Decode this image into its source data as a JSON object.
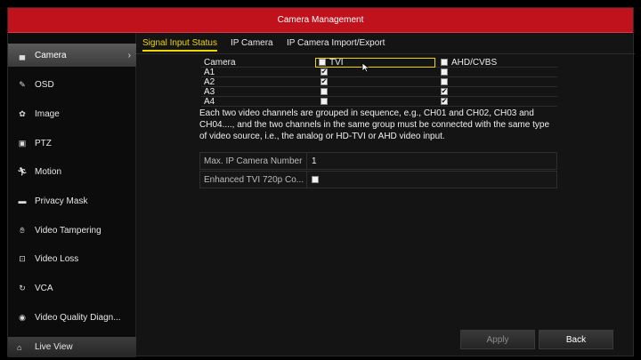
{
  "window": {
    "title": "Camera Management"
  },
  "sidebar": {
    "items": [
      {
        "label": "Camera",
        "icon": "camera-icon"
      },
      {
        "label": "OSD",
        "icon": "pencil-icon"
      },
      {
        "label": "Image",
        "icon": "image-icon"
      },
      {
        "label": "PTZ",
        "icon": "ptz-icon"
      },
      {
        "label": "Motion",
        "icon": "motion-icon"
      },
      {
        "label": "Privacy Mask",
        "icon": "privacy-mask-icon"
      },
      {
        "label": "Video Tampering",
        "icon": "hand-icon"
      },
      {
        "label": "Video Loss",
        "icon": "video-loss-icon"
      },
      {
        "label": "VCA",
        "icon": "vca-icon"
      },
      {
        "label": "Video Quality Diagn...",
        "icon": "diagnostic-icon"
      }
    ],
    "active_index": 0,
    "live_view": "Live View"
  },
  "tabs": [
    "Signal Input Status",
    "IP Camera",
    "IP Camera Import/Export"
  ],
  "table": {
    "header": {
      "label": "Camera",
      "col1": "TVI",
      "col2": "AHD/CVBS"
    },
    "rows": [
      {
        "label": "A1",
        "tvi": true,
        "ahd": false
      },
      {
        "label": "A2",
        "tvi": true,
        "ahd": false
      },
      {
        "label": "A3",
        "tvi": false,
        "ahd": true
      },
      {
        "label": "A4",
        "tvi": false,
        "ahd": true
      }
    ]
  },
  "note": "Each two video channels are grouped in sequence, e.g., CH01 and CH02, CH03 and CH04...., and the two channels in the same group must be connected with the same type of video source, i.e., the analog or HD-TVI or AHD video input.",
  "fields": {
    "max_ip_label": "Max. IP Camera Number",
    "max_ip_value": "1",
    "enhanced_label": "Enhanced TVI 720p Co...",
    "enhanced_checked": false
  },
  "buttons": {
    "apply": "Apply",
    "back": "Back"
  },
  "colors": {
    "title_bar": "#c0121d",
    "active_tab": "#f0d400"
  }
}
